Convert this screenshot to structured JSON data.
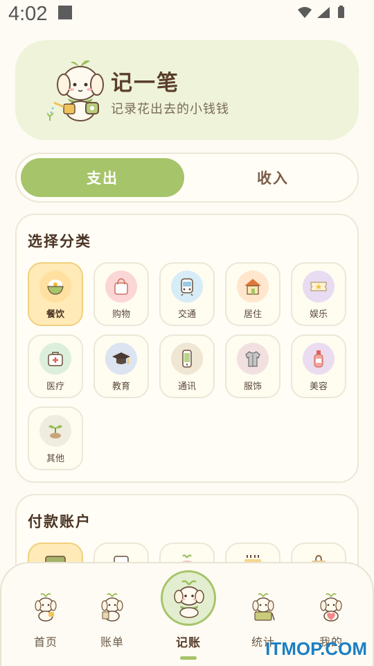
{
  "status_bar": {
    "time": "4:02"
  },
  "header": {
    "title": "记一笔",
    "subtitle": "记录花出去的小钱钱"
  },
  "toggle": {
    "expense_label": "支出",
    "income_label": "收入",
    "active": "expense"
  },
  "categories": {
    "title": "选择分类",
    "selected": "餐饮",
    "items": [
      {
        "label": "餐饮",
        "icon": "rice-bowl-icon",
        "color": "#ffe0a0"
      },
      {
        "label": "购物",
        "icon": "shopping-bag-icon",
        "color": "#fbd6d6"
      },
      {
        "label": "交通",
        "icon": "train-icon",
        "color": "#d6ecf6"
      },
      {
        "label": "居住",
        "icon": "house-icon",
        "color": "#ffe6cc"
      },
      {
        "label": "娱乐",
        "icon": "ticket-icon",
        "color": "#e8dcf2"
      },
      {
        "label": "医疗",
        "icon": "medical-kit-icon",
        "color": "#dcefdc"
      },
      {
        "label": "教育",
        "icon": "graduation-cap-icon",
        "color": "#dbe4f0"
      },
      {
        "label": "通讯",
        "icon": "phone-icon",
        "color": "#efe6d4"
      },
      {
        "label": "服饰",
        "icon": "shirt-icon",
        "color": "#f2e0e0"
      },
      {
        "label": "美容",
        "icon": "lotion-bottle-icon",
        "color": "#ecdcf0"
      },
      {
        "label": "其他",
        "icon": "sprout-icon",
        "color": "#efece0"
      }
    ]
  },
  "payment": {
    "title": "付款账户",
    "items": [
      {
        "icon": "wallet-icon"
      },
      {
        "icon": "card-icon"
      },
      {
        "icon": "piggy-icon"
      },
      {
        "icon": "bank-icon"
      },
      {
        "icon": "bag-icon"
      }
    ]
  },
  "nav": {
    "items": [
      {
        "label": "首页",
        "icon": "mascot-home-icon"
      },
      {
        "label": "账单",
        "icon": "mascot-bill-icon"
      },
      {
        "label": "记账",
        "icon": "mascot-record-icon",
        "active": true
      },
      {
        "label": "统计",
        "icon": "mascot-stats-icon"
      },
      {
        "label": "我的",
        "icon": "mascot-profile-icon"
      }
    ]
  },
  "watermark": "ITMOP.COM",
  "colors": {
    "accent": "#a6c46a",
    "brown": "#5a3e2b",
    "selected_bg": "#ffeab8"
  }
}
